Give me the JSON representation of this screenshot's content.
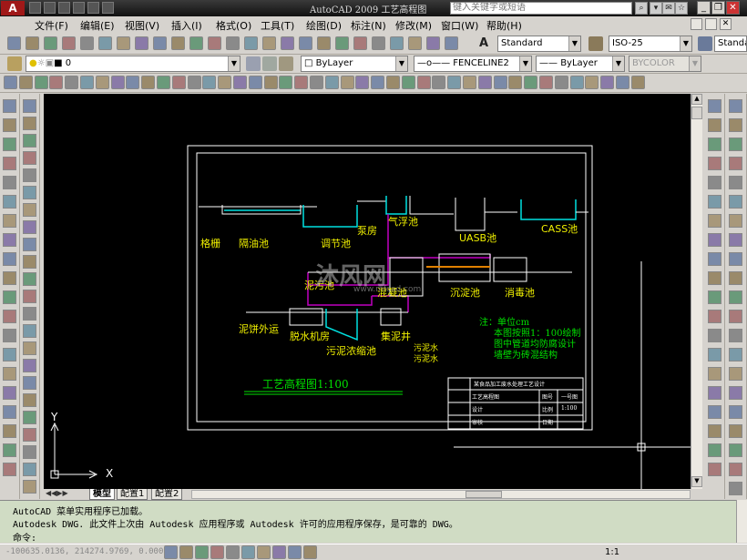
{
  "titlebar": {
    "app_title": "AutoCAD 2009  工艺高程图",
    "search_placeholder": "键入关键字或短语"
  },
  "menu": [
    "文件(F)",
    "编辑(E)",
    "视图(V)",
    "插入(I)",
    "格式(O)",
    "工具(T)",
    "绘图(D)",
    "标注(N)",
    "修改(M)",
    "窗口(W)",
    "帮助(H)"
  ],
  "toolbar": {
    "text_style": "Standard",
    "dim_style": "ISO-25",
    "table_style": "Standar",
    "layer": "0",
    "color": "ByLayer",
    "linetype": "FENCELINE2",
    "lineweight": "ByLayer",
    "plotstyle": "BYCOLOR"
  },
  "drawing": {
    "labels": {
      "grille": "格栅",
      "grit": "隔油池",
      "equal": "调节池",
      "pump": "泵房",
      "airfloat": "气浮池",
      "uasb": "UASB池",
      "cass": "CASS池",
      "sludge_rev": "泥污池",
      "mid": "混凝池",
      "settle": "沉淀池",
      "disinfect": "消毒池",
      "sludge_out": "泥饼外运",
      "dewater": "脱水机房",
      "thicken": "污泥浓缩池",
      "collect": "集泥井",
      "overflow1": "污泥水",
      "overflow2": "污泥水",
      "note1": "注：单位cm",
      "note2": "本图按照1：100绘制",
      "note3": "图中管道均防腐设计",
      "note4": "墙壁为砖混结构",
      "main_title": "工艺高程图1:100"
    },
    "watermark_text": "沐风网",
    "watermark_url": "www.mfcad.com",
    "titleblock": {
      "r0": "某食品加工废水处理工艺设计",
      "r1c1": "工艺高程图",
      "r1c2": "图号",
      "r1c3": "一号图",
      "r2c1": "设计",
      "r2c2": "比例",
      "r2c3": "1:100",
      "r3c1": "审核",
      "r3c2": "日期"
    },
    "ucs_x": "X",
    "ucs_y": "Y"
  },
  "tabs": [
    "模型",
    "配置1",
    "配置2"
  ],
  "command": {
    "line1": "AutoCAD 菜单实用程序已加载。",
    "line2": "Autodesk DWG.  此文件上次由 Autodesk 应用程序或 Autodesk 许可的应用程序保存，是可靠的 DWG。",
    "prompt": "命令:"
  },
  "status": {
    "coords": "-100635.0136, 214274.9769, 0.0000",
    "annotation_scale": "1:1"
  },
  "colors": {
    "canvas": "#000000",
    "frame": "#ffffff",
    "label_yellow": "#f0f000",
    "label_green": "#00e000",
    "pipe_magenta": "#c000c0",
    "pipe_cyan": "#00e0e0"
  }
}
